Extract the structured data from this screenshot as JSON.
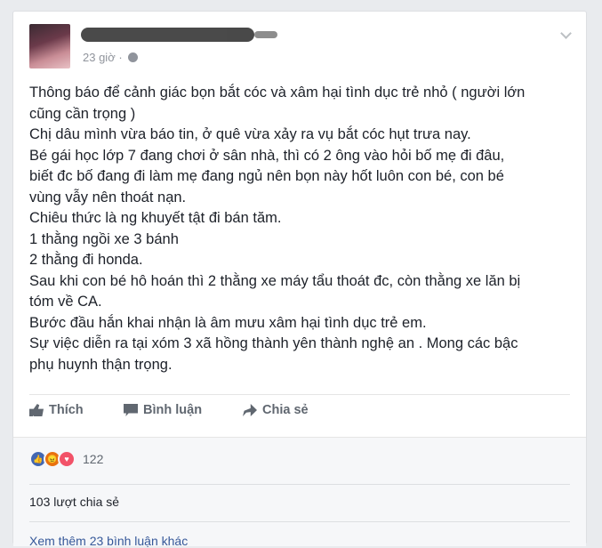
{
  "post": {
    "timestamp": "23 giờ ·",
    "lines": [
      "Thông báo để cảnh giác bọn bắt cóc và xâm hại tình dục trẻ nhỏ ( người lớn",
      "cũng cần trọng )",
      "Chị dâu mình vừa báo tin, ở quê vừa xảy ra vụ bắt cóc hụt trưa nay.",
      "Bé gái học lớp 7 đang chơi ở sân nhà, thì có 2 ông vào hỏi bố mẹ đi đâu,",
      "biết đc bố đang đi làm mẹ đang ngủ nên bọn này hốt luôn con bé, con bé",
      "vùng vẫy nên thoát nạn.",
      "Chiêu thức là ng khuyết tật đi bán tăm.",
      "1 thằng ngồi xe 3 bánh",
      "2 thằng đi honda.",
      "Sau khi con bé hô hoán thì 2 thằng xe máy tẩu thoát đc, còn thằng xe lăn bị",
      "tóm về CA.",
      "Bước đầu hắn khai nhận là âm mưu xâm hại tình dục trẻ em.",
      "Sự việc diễn ra tại xóm 3 xã hồng thành yên thành nghệ an . Mong các bậc",
      "phụ huynh thận trọng."
    ]
  },
  "actions": {
    "like": "Thích",
    "comment": "Bình luận",
    "share": "Chia sẻ"
  },
  "stats": {
    "reaction_count": "122",
    "shares": "103 lượt chia sẻ",
    "more_comments": "Xem thêm 23 bình luận khác"
  },
  "colors": {
    "like": "#4267b2",
    "angry": "#e9710f",
    "love": "#f25268",
    "link": "#365899"
  }
}
